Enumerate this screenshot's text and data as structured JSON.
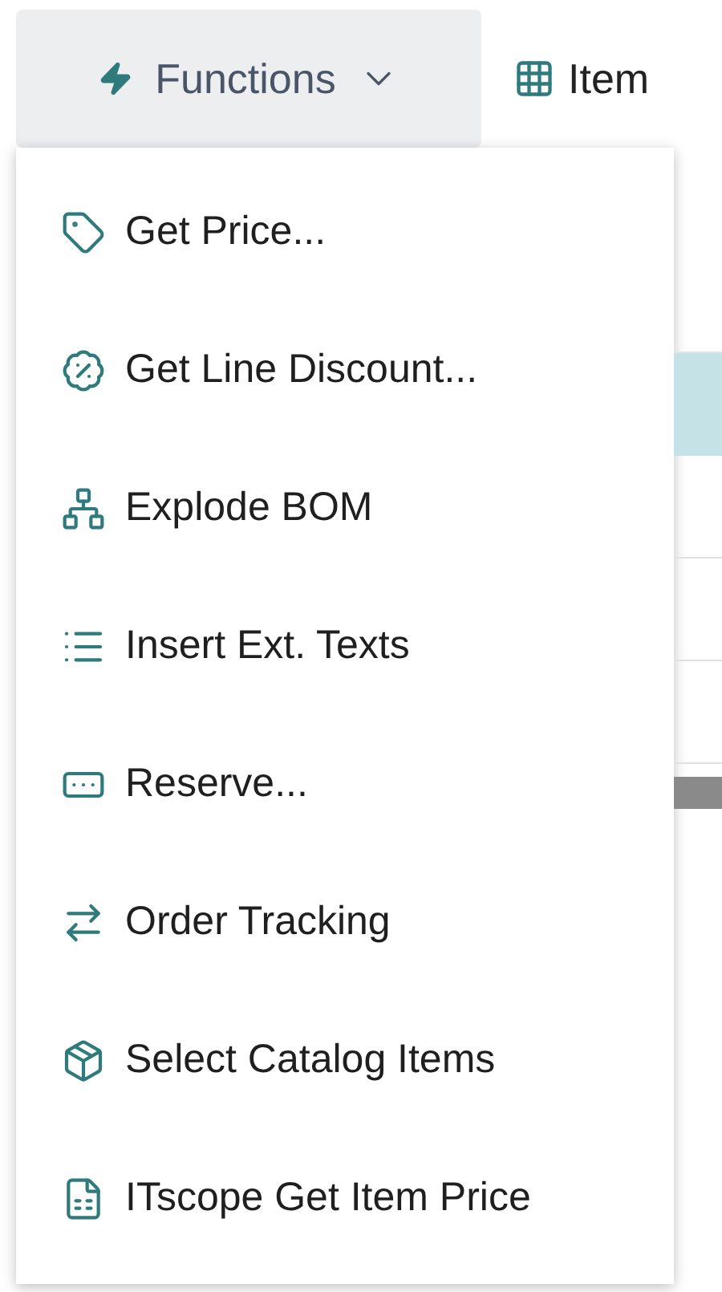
{
  "toolbar": {
    "functions_button": {
      "label": "Functions",
      "expanded": true
    },
    "item_button": {
      "label": "Item"
    }
  },
  "menu": {
    "items": [
      {
        "label": "Get Price..."
      },
      {
        "label": "Get Line Discount..."
      },
      {
        "label": "Explode BOM"
      },
      {
        "label": "Insert Ext. Texts"
      },
      {
        "label": "Reserve..."
      },
      {
        "label": "Order Tracking"
      },
      {
        "label": "Select Catalog Items"
      },
      {
        "label": "ITscope Get Item Price"
      }
    ]
  }
}
